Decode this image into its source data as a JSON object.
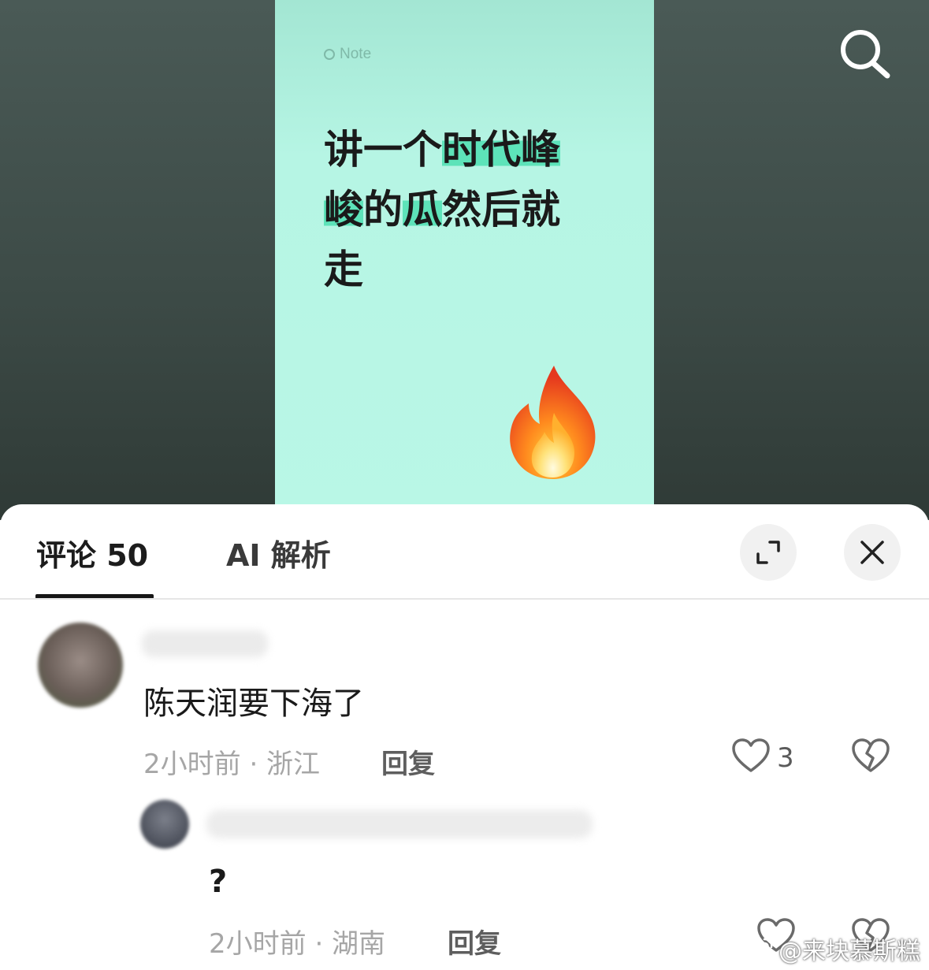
{
  "video": {
    "note_tag": "Note",
    "headline_parts": [
      {
        "text": "讲一个",
        "highlight": false
      },
      {
        "text": "时代峰峻",
        "highlight": true
      },
      {
        "text": "的",
        "highlight": false
      },
      {
        "text": "瓜",
        "highlight": true
      },
      {
        "text": "然后就走",
        "highlight": false
      }
    ],
    "emoji": "fire-emoji",
    "background_color": "#b9f7e6",
    "highlight_color": "#5de3b9"
  },
  "header": {
    "search_icon": "search-icon"
  },
  "sheet": {
    "tabs": [
      {
        "label": "评论 50",
        "active": true
      },
      {
        "label": "AI 解析",
        "active": false
      }
    ],
    "expand_icon": "expand-icon",
    "close_icon": "close-icon"
  },
  "comments": [
    {
      "username": "",
      "text": "陈天润要下海了",
      "meta": "2小时前 · 浙江",
      "reply_label": "回复",
      "likes": "3"
    },
    {
      "username": "",
      "text": "?",
      "meta": "2小时前 · 湖南",
      "reply_label": "回复",
      "likes": ""
    }
  ],
  "watermark": {
    "text": "@来块慕斯糕"
  }
}
